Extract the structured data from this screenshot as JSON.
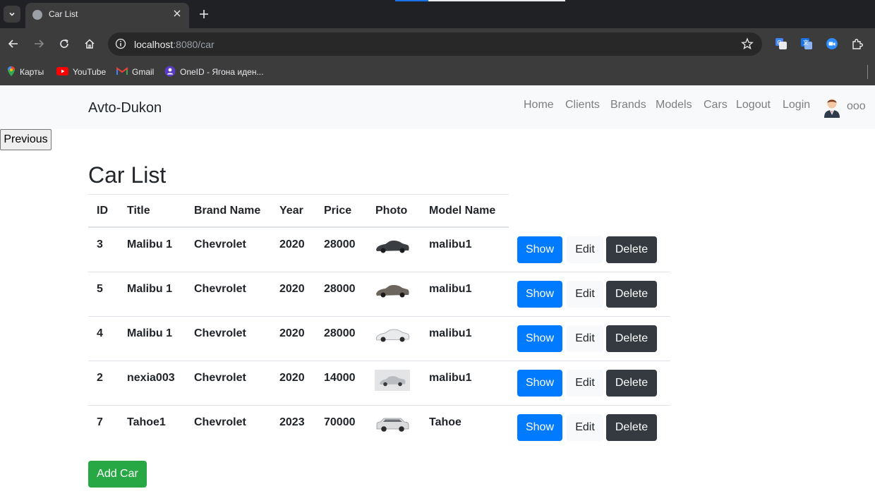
{
  "browser": {
    "tab_title": "Car List",
    "url_host": "localhost",
    "url_rest": ":8080/car",
    "bookmarks": [
      {
        "label": "Карты",
        "icon": "maps-pin-icon"
      },
      {
        "label": "YouTube",
        "icon": "youtube-icon"
      },
      {
        "label": "Gmail",
        "icon": "gmail-icon"
      },
      {
        "label": "OneID - Ягона иден...",
        "icon": "oneid-icon"
      }
    ]
  },
  "navbar": {
    "brand": "Avto-Dukon",
    "links": [
      "Home",
      "Clients",
      "Brands",
      "Models",
      "Cars",
      "Logout",
      "Login"
    ],
    "user": "ooo"
  },
  "previous_button": "Previous",
  "page_title": "Car List",
  "table": {
    "headers": [
      "ID",
      "Title",
      "Brand Name",
      "Year",
      "Price",
      "Photo",
      "Model Name"
    ],
    "rows": [
      {
        "id": "3",
        "title": "Malibu 1",
        "brand": "Chevrolet",
        "year": "2020",
        "price": "28000",
        "model": "malibu1",
        "photo_color": "#3a3d42"
      },
      {
        "id": "5",
        "title": "Malibu 1",
        "brand": "Chevrolet",
        "year": "2020",
        "price": "28000",
        "model": "malibu1",
        "photo_color": "#6b655e"
      },
      {
        "id": "4",
        "title": "Malibu 1",
        "brand": "Chevrolet",
        "year": "2020",
        "price": "28000",
        "model": "malibu1",
        "photo_color": "#e9eaec"
      },
      {
        "id": "2",
        "title": "nexia003",
        "brand": "Chevrolet",
        "year": "2020",
        "price": "14000",
        "model": "malibu1",
        "photo_color": "#b9bcc0"
      },
      {
        "id": "7",
        "title": "Tahoe1",
        "brand": "Chevrolet",
        "year": "2023",
        "price": "70000",
        "model": "Tahoe",
        "photo_color": "#d9dadc"
      }
    ],
    "actions": {
      "show": "Show",
      "edit": "Edit",
      "delete": "Delete"
    }
  },
  "add_button": "Add Car",
  "colors": {
    "primary": "#007bff",
    "dark": "#343a40",
    "success": "#28a745",
    "light": "#f8f9fa"
  }
}
